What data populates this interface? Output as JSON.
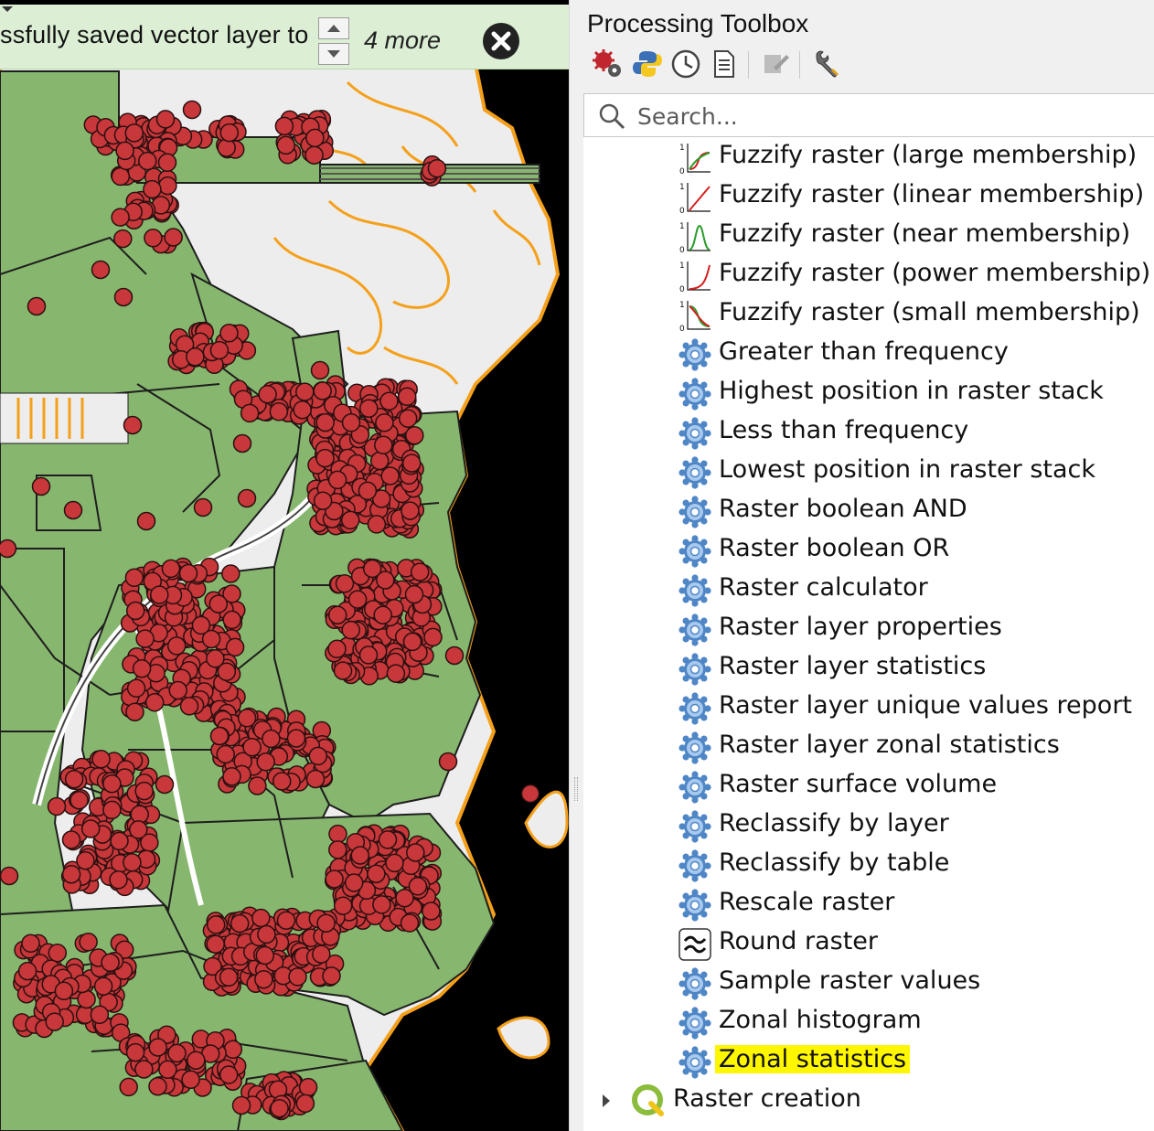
{
  "message_bar": {
    "text": "ssfully saved vector layer to",
    "more": "4 more"
  },
  "toolbox": {
    "title": "Processing Toolbox",
    "toolbar_icons": [
      "models-icon",
      "python-icon",
      "history-icon",
      "results-viewer-icon",
      "edit-in-place-icon",
      "options-icon"
    ],
    "search": {
      "placeholder": "Search...",
      "value": ""
    },
    "items": [
      {
        "label": "Fuzzify raster (large membership)",
        "icon": "fuzzify-large-icon"
      },
      {
        "label": "Fuzzify raster (linear membership)",
        "icon": "fuzzify-linear-icon"
      },
      {
        "label": "Fuzzify raster (near membership)",
        "icon": "fuzzify-near-icon"
      },
      {
        "label": "Fuzzify raster (power membership)",
        "icon": "fuzzify-power-icon"
      },
      {
        "label": "Fuzzify raster (small membership)",
        "icon": "fuzzify-small-icon"
      },
      {
        "label": "Greater than frequency",
        "icon": "gear-icon"
      },
      {
        "label": "Highest position in raster stack",
        "icon": "gear-icon"
      },
      {
        "label": "Less than frequency",
        "icon": "gear-icon"
      },
      {
        "label": "Lowest position in raster stack",
        "icon": "gear-icon"
      },
      {
        "label": "Raster boolean AND",
        "icon": "gear-icon"
      },
      {
        "label": "Raster boolean OR",
        "icon": "gear-icon"
      },
      {
        "label": "Raster calculator",
        "icon": "gear-icon"
      },
      {
        "label": "Raster layer properties",
        "icon": "gear-icon"
      },
      {
        "label": "Raster layer statistics",
        "icon": "gear-icon"
      },
      {
        "label": "Raster layer unique values report",
        "icon": "gear-icon"
      },
      {
        "label": "Raster layer zonal statistics",
        "icon": "gear-icon"
      },
      {
        "label": "Raster surface volume",
        "icon": "gear-icon"
      },
      {
        "label": "Reclassify by layer",
        "icon": "gear-icon"
      },
      {
        "label": "Reclassify by table",
        "icon": "gear-icon"
      },
      {
        "label": "Rescale raster",
        "icon": "gear-icon"
      },
      {
        "label": "Round raster",
        "icon": "round-raster-icon"
      },
      {
        "label": "Sample raster values",
        "icon": "gear-icon"
      },
      {
        "label": "Zonal histogram",
        "icon": "gear-icon"
      },
      {
        "label": "Zonal statistics",
        "icon": "gear-icon",
        "highlighted": true
      }
    ],
    "groups": [
      {
        "label": "Raster creation",
        "icon": "qgis-provider-icon",
        "expanded": false
      }
    ]
  },
  "colors": {
    "map_background": "#000000",
    "land": "#ededed",
    "outline": "#f5a01a",
    "parcels": "#87b76e",
    "points": "#c8373a",
    "message_bar": "#dcefd5",
    "highlight": "#fff700"
  }
}
